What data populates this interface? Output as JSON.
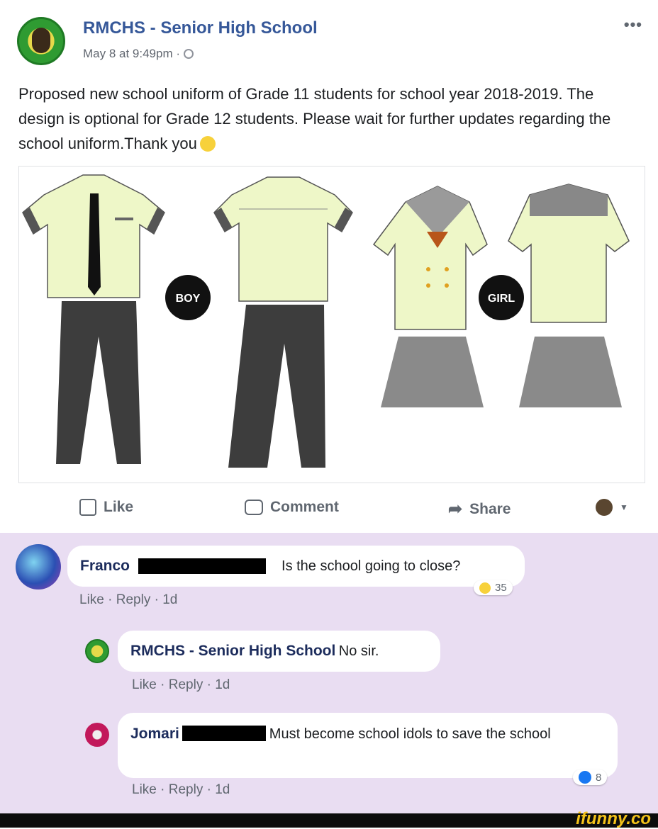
{
  "post": {
    "page_name": "RMCHS - Senior High School",
    "meta": "May 8 at 9:49pm · ",
    "text": "Proposed new school uniform of Grade 11 students for school year 2018-2019. The design is optional for Grade 12 students. Please wait for further updates regarding the school uniform.Thank you",
    "image_labels": {
      "boy": "BOY",
      "girl": "GIRL"
    }
  },
  "actions": {
    "like": "Like",
    "comment": "Comment",
    "share": "Share"
  },
  "comments": [
    {
      "name": "Franco",
      "text": "Is the school going to close?",
      "like": "Like",
      "reply": "Reply",
      "time": "1d",
      "reaction_count": "35"
    },
    {
      "name": "RMCHS - Senior High School",
      "text": "No sir.",
      "like": "Like",
      "reply": "Reply",
      "time": "1d"
    },
    {
      "name": "Jomari",
      "text": "Must become school idols to save the school",
      "like": "Like",
      "reply": "Reply",
      "time": "1d",
      "reaction_count": "8"
    }
  ],
  "watermark": "ifunny.co",
  "colors": {
    "page_link": "#365899",
    "comment_bg": "#e9ddf2",
    "shirt": "#eef7c8",
    "pants": "#3d3d3d",
    "skirt": "#8a8a8a",
    "watermark": "#f3c21a"
  }
}
